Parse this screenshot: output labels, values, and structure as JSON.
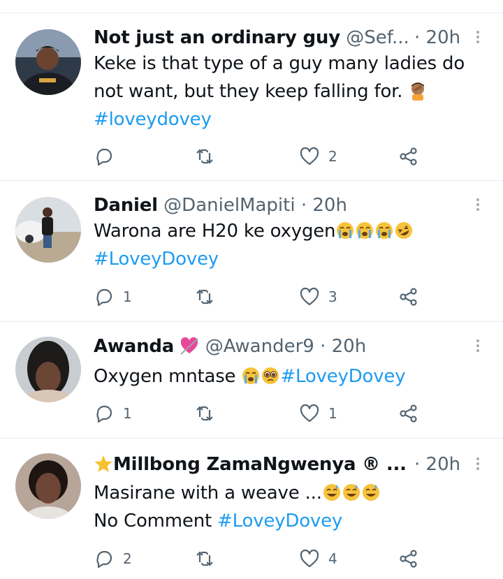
{
  "tweets": [
    {
      "name": "Not just an ordinary guy",
      "handle": "@Sef...",
      "time": "· 20h",
      "lines": [
        {
          "text": "Keke is that type of a guy many ladies do",
          "tag": ""
        },
        {
          "text": "not want, but they keep falling for. ",
          "tag": ""
        },
        {
          "text": "",
          "tag": "#loveydovey"
        }
      ],
      "emoji_after_line2": "facepalm",
      "reply_count": "",
      "like_count": "2"
    },
    {
      "name": "Daniel",
      "handle": "@DanielMapiti",
      "time": "· 20h",
      "lines": [
        {
          "text": "Warona are H20 ke oxygen",
          "tag": ""
        },
        {
          "text": "",
          "tag": "#LoveyDovey"
        }
      ],
      "emojis_line1": [
        "crying",
        "crying",
        "crying",
        "rofl"
      ],
      "reply_count": "1",
      "like_count": "3"
    },
    {
      "name": "Awanda",
      "handle": "@Awander9",
      "time": "· 20h",
      "lines": [
        {
          "text": "Oxygen mntase ",
          "tag": "#LoveyDovey"
        }
      ],
      "emojis_line1": [
        "crying",
        "pleading"
      ],
      "reply_count": "1",
      "like_count": "1"
    },
    {
      "name": "Millbong ZamaNgwenya ® ...",
      "handle": "",
      "time": "· 20h",
      "lines": [
        {
          "text": "Masirane with a weave ...",
          "tag": ""
        },
        {
          "text": "No Comment ",
          "tag": "#LoveyDovey"
        }
      ],
      "emojis_line1": [
        "grin-sweat",
        "grin-sweat",
        "grin-sweat"
      ],
      "reply_count": "2",
      "like_count": "4"
    }
  ],
  "icons": {
    "reply": "reply-icon",
    "retweet": "retweet-icon",
    "like": "heart-icon",
    "share": "share-icon",
    "more": "more-vertical-icon"
  },
  "colors": {
    "text": "#0f1419",
    "secondary": "#536471",
    "hashtag": "#1d9bf0",
    "divider": "#e6ecf0"
  }
}
